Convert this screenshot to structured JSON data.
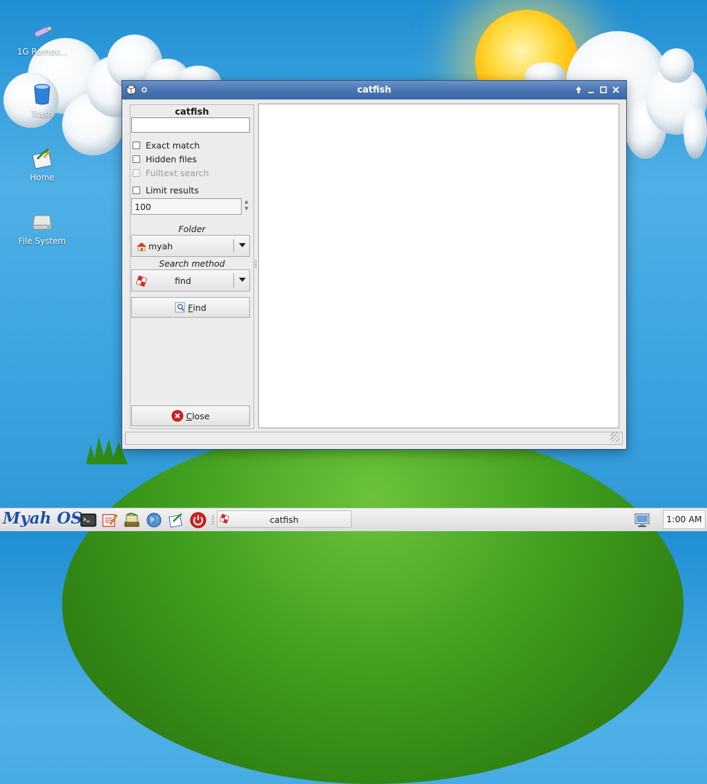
{
  "desktop": {
    "icons": [
      {
        "label": "1G Remov..."
      },
      {
        "label": "Trash"
      },
      {
        "label": "Home"
      },
      {
        "label": "File System"
      }
    ]
  },
  "window": {
    "title": "catfish",
    "panel_title": "catfish",
    "search": {
      "value": "",
      "placeholder": ""
    },
    "options": {
      "exact_match": {
        "label": "Exact match",
        "checked": false
      },
      "hidden_files": {
        "label": "Hidden files",
        "checked": false
      },
      "fulltext_search": {
        "label": "Fulltext search",
        "checked": false,
        "enabled": false
      },
      "limit_results": {
        "label": "Limit results",
        "checked": false
      }
    },
    "limit_value": "100",
    "folder": {
      "label": "Folder",
      "value": "myah"
    },
    "search_method": {
      "label": "Search method",
      "value": "find"
    },
    "find_button": {
      "mnemonic": "F",
      "rest": "ind"
    },
    "close_button": {
      "mnemonic": "C",
      "rest": "lose"
    }
  },
  "taskbar": {
    "logo": "Myah OS",
    "task": {
      "label": "catfish"
    },
    "clock": "1:00 AM"
  },
  "colors": {
    "titlebar": "#4a76b3",
    "desktop_sky": "#3aa4e0",
    "close_red": "#d81e1e"
  },
  "icons": [
    "usb-drive-icon",
    "trash-icon",
    "home-icon",
    "file-system-icon",
    "window-menu-icon",
    "sticky-icon",
    "shade-icon",
    "minimize-icon",
    "maximize-icon",
    "close-icon",
    "home-folder-icon",
    "catfish-method-icon",
    "find-icon",
    "close-circle-icon",
    "terminal-icon",
    "text-editor-icon",
    "file-manager-icon",
    "web-browser-icon",
    "notes-icon",
    "power-icon",
    "network-monitor-icon"
  ]
}
